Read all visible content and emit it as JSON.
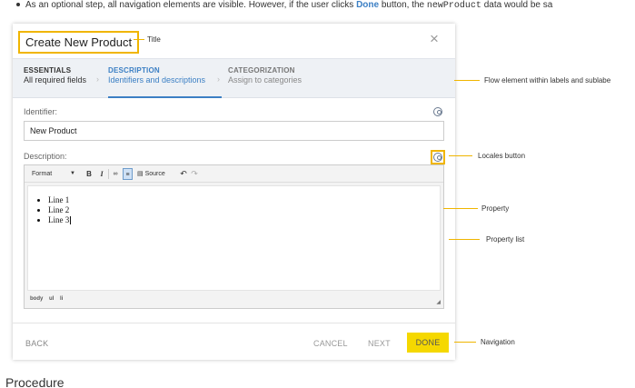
{
  "note": {
    "text_before": "As an optional step, all navigation elements are visible. However, if the user clicks",
    "done_keyword": "Done",
    "text_middle": "button, the",
    "code": "newProduct",
    "text_after": "data would be sa"
  },
  "dialog": {
    "title": "Create New Product",
    "close": "×"
  },
  "flow": {
    "steps": [
      {
        "title": "ESSENTIALS",
        "subtitle": "All required fields"
      },
      {
        "title": "DESCRIPTION",
        "subtitle": "Identifiers and descriptions"
      },
      {
        "title": "CATEGORIZATION",
        "subtitle": "Assign to categories"
      }
    ],
    "separator": "›"
  },
  "fields": {
    "identifier_label": "Identifier:",
    "identifier_value": "New Product",
    "description_label": "Description:"
  },
  "toolbar": {
    "format": "Format",
    "bold": "B",
    "italic": "I",
    "source": "Source",
    "undo": "↶",
    "redo": "↷"
  },
  "editor": {
    "lines": [
      "Line 1",
      "Line 2",
      "Line 3"
    ],
    "path": [
      "body",
      "ul",
      "li"
    ]
  },
  "navigation": {
    "back": "BACK",
    "cancel": "CANCEL",
    "next": "NEXT",
    "done": "DONE"
  },
  "callouts": {
    "title": "Title",
    "flow": "Flow element within labels and sublabe",
    "locales": "Locales button",
    "property": "Property",
    "property_list": "Property list",
    "navigation": "Navigation"
  },
  "section_heading": "Procedure",
  "colors": {
    "accent": "#3b7fc4",
    "callout": "#f0b500",
    "done_button": "#f5d800"
  }
}
